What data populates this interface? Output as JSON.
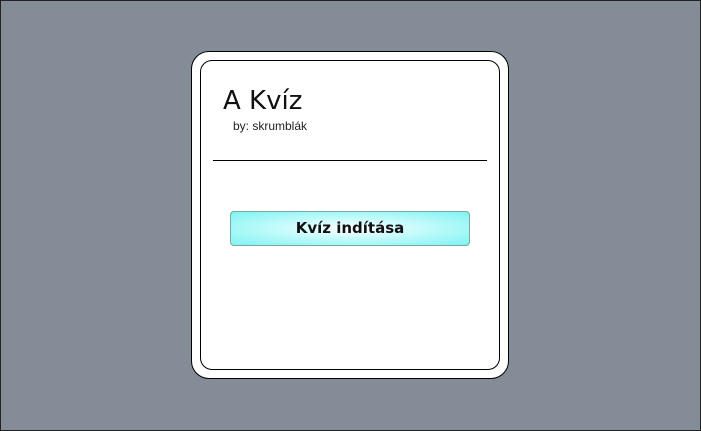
{
  "quiz": {
    "title": "A Kvíz",
    "author": "by: skrumblák",
    "start_button_label": "Kvíz indítása"
  }
}
